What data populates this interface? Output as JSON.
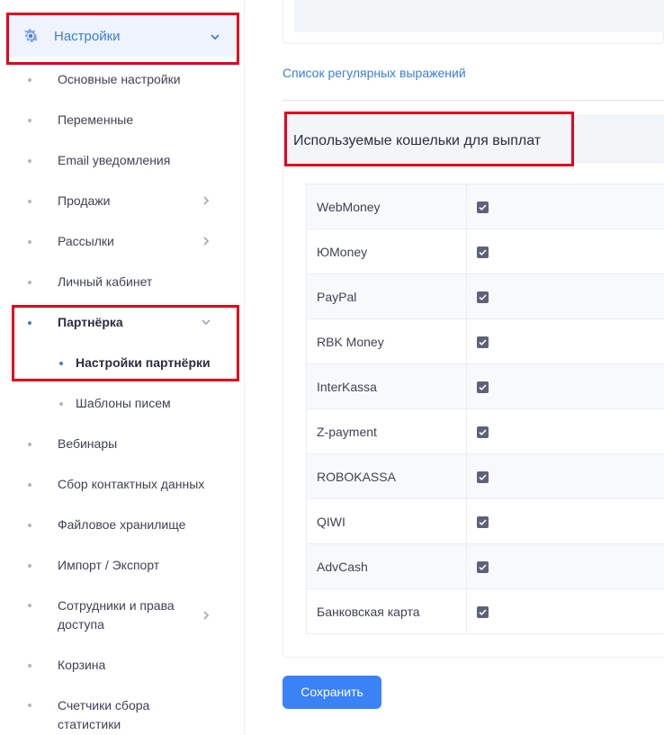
{
  "sidebar": {
    "section": {
      "label": "Настройки",
      "icon": "gear-icon",
      "accent": "#3b7ddd"
    },
    "items": [
      {
        "label": "Основные настройки"
      },
      {
        "label": "Переменные"
      },
      {
        "label": "Email уведомления"
      },
      {
        "label": "Продажи",
        "has_submenu": true
      },
      {
        "label": "Рассылки",
        "has_submenu": true
      },
      {
        "label": "Личный кабинет"
      },
      {
        "label": "Партнёрка",
        "expanded": true
      },
      {
        "label": "Настройки партнёрки",
        "active": true
      },
      {
        "label": "Шаблоны писем"
      },
      {
        "label": "Вебинары"
      },
      {
        "label": "Сбор контактных данных"
      },
      {
        "label": "Файловое хранилище"
      },
      {
        "label": "Импорт / Экспорт"
      },
      {
        "label_line1": "Сотрудники и права",
        "label_line2": "доступа",
        "has_submenu": true
      },
      {
        "label": "Корзина"
      },
      {
        "label_line1": "Счетчики сбора",
        "label_line2": "статистики"
      }
    ]
  },
  "main": {
    "regex_link": "Список регулярных выражений",
    "wallets": {
      "title": "Используемые кошельки для выплат",
      "rows": [
        {
          "name": "WebMoney",
          "checked": true
        },
        {
          "name": "ЮMoney",
          "checked": true
        },
        {
          "name": "PayPal",
          "checked": true
        },
        {
          "name": "RBK Money",
          "checked": true
        },
        {
          "name": "InterKassa",
          "checked": true
        },
        {
          "name": "Z-payment",
          "checked": true
        },
        {
          "name": "ROBOKASSA",
          "checked": true
        },
        {
          "name": "QIWI",
          "checked": true
        },
        {
          "name": "AdvCash",
          "checked": true
        },
        {
          "name": "Банковская карта",
          "checked": true
        }
      ]
    },
    "save_label": "Сохранить"
  },
  "colors": {
    "accent": "#3b7ddd",
    "button": "#3b82f6",
    "highlight": "#e3001b"
  }
}
